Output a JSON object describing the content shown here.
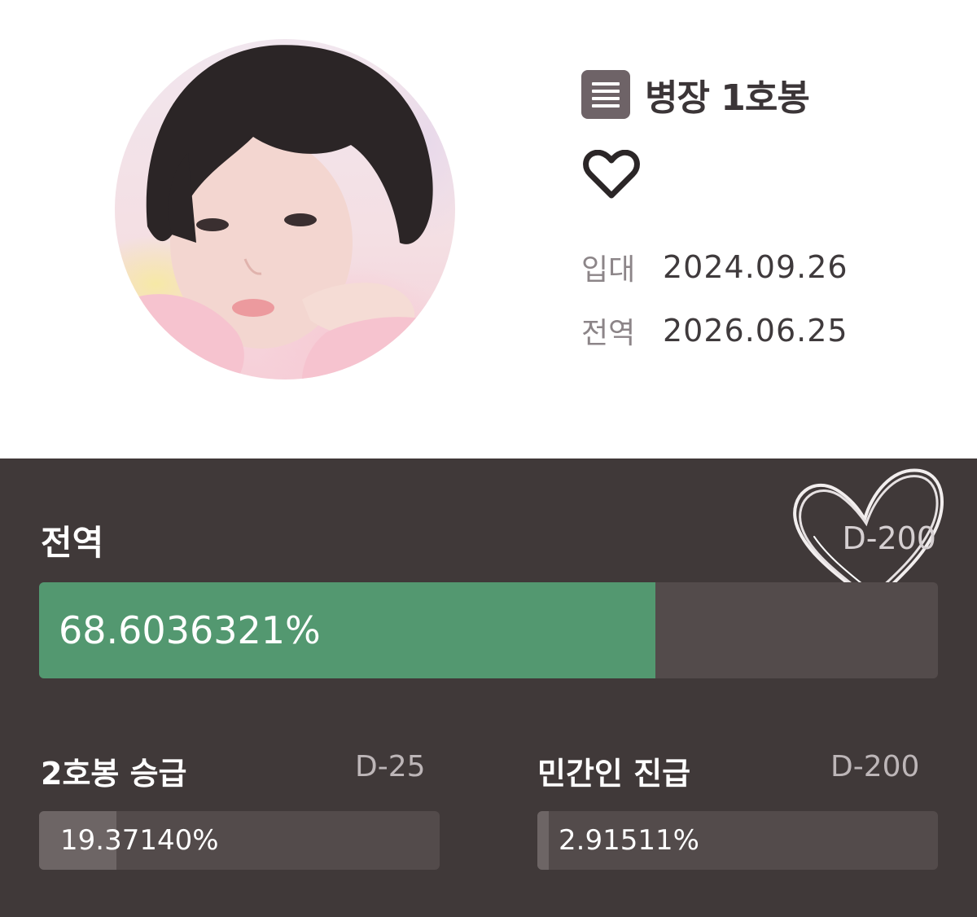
{
  "profile": {
    "rank_title": "병장 1호봉",
    "enlist": {
      "label": "입대",
      "date": "2024.09.26"
    },
    "discharge": {
      "label": "전역",
      "date": "2026.06.25"
    }
  },
  "main_progress": {
    "label": "전역",
    "dday": "D-200",
    "percent_text": "68.6036321%",
    "fraction": 0.686
  },
  "sub_progress": [
    {
      "label": "2호봉 승급",
      "dday": "D-25",
      "percent_text": "19.37140%",
      "fraction": 0.1937
    },
    {
      "label": "민간인 진급",
      "dday": "D-200",
      "percent_text": "2.91511%",
      "fraction": 0.0292
    }
  ],
  "colors": {
    "card_background": "#403939",
    "bar_track": "#534b4b",
    "main_fill": "#539870",
    "sub_fill": "#6d6565"
  }
}
